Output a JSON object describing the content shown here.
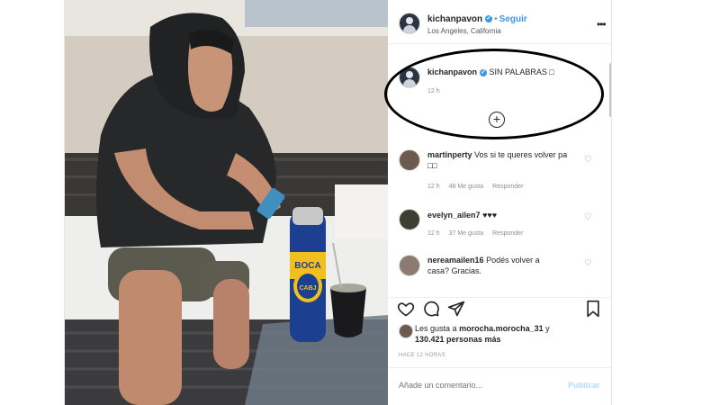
{
  "header": {
    "username": "kichanpavon",
    "follow_label": "Seguir",
    "location": "Los Angeles, California"
  },
  "caption": {
    "username": "kichanpavon",
    "text": "SIN PALABRAS □",
    "time": "12 h"
  },
  "comments": [
    {
      "username": "martinperty",
      "text": "Vos si te queres volver pa □□",
      "time": "12 h",
      "likes": "48 Me gusta",
      "reply": "Responder"
    },
    {
      "username": "evelyn_ailen7",
      "text": "♥♥♥",
      "time": "12 h",
      "likes": "37 Me gusta",
      "reply": "Responder"
    },
    {
      "username": "nereamailen16",
      "text": "Podés volver a casa? Gracias.",
      "time": "",
      "likes": "",
      "reply": ""
    }
  ],
  "likes": {
    "prefix": "Les gusta a",
    "user": "morocha.morocha_31",
    "suffix": "y",
    "count": "130.421 personas más"
  },
  "post_time": "HACE 12 HORAS",
  "comment_input": {
    "placeholder": "Añade un comentario..."
  },
  "publish_label": "Publicar",
  "photo": {
    "can_text_top": "BOCA",
    "can_text_bottom": "CABJ"
  },
  "colors": {
    "accent": "#3897f0",
    "annotation": "#000000"
  }
}
